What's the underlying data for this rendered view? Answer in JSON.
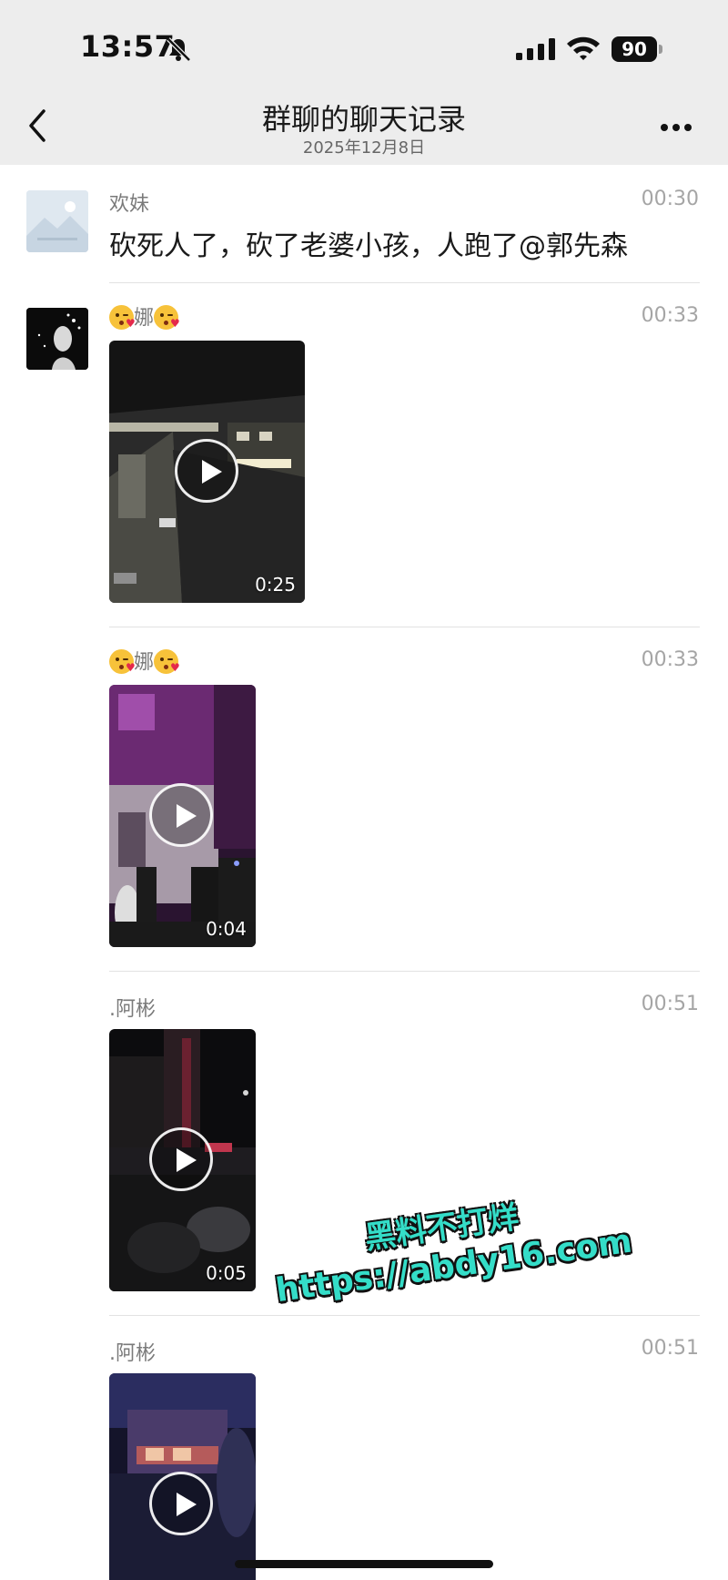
{
  "status_bar": {
    "time": "13:57",
    "battery": "90",
    "icons": [
      "bell-off-icon",
      "signal-icon",
      "wifi-icon",
      "battery-icon"
    ]
  },
  "nav": {
    "title": "群聊的聊天记录",
    "subtitle": "2025年12月8日",
    "back_icon": "chevron-left-icon",
    "more_icon": "more-icon"
  },
  "messages": [
    {
      "sender": "欢妹",
      "time": "00:30",
      "type": "text",
      "text": "砍死人了，砍了老婆小孩，人跑了@郭先森"
    },
    {
      "sender": "娜",
      "sender_emoji": "kissing-face-emoji",
      "time": "00:33",
      "type": "video",
      "duration": "0:25"
    },
    {
      "sender": "娜",
      "sender_emoji": "kissing-face-emoji",
      "time": "00:33",
      "type": "video",
      "duration": "0:04"
    },
    {
      "sender": ".阿彬",
      "time": "00:51",
      "type": "video",
      "duration": "0:05"
    },
    {
      "sender": ".阿彬",
      "time": "00:51",
      "type": "video"
    }
  ],
  "watermark": {
    "line1": "黑料不打烊",
    "line2": "https://abdy16.com"
  },
  "colors": {
    "header_bg": "#ededed",
    "sender": "#7a7a7a",
    "time": "#a5a5a5",
    "watermark": "#34ddc8"
  }
}
